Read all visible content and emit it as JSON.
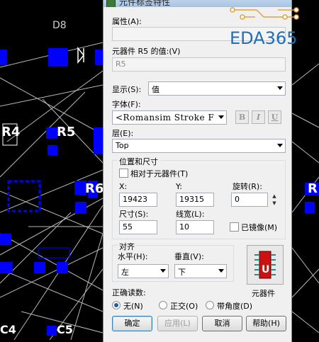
{
  "dialog": {
    "title": "元件标签特性",
    "attribute_label": "属性(A):",
    "attribute_value": "",
    "value_label": "元器件 R5 的值:(V)",
    "value_value": "R5",
    "display_label": "显示(S):",
    "display_value": "值",
    "font_label": "字体(F):",
    "font_value": "<Romansim Stroke F",
    "font_style_bold": "B",
    "font_style_italic": "I",
    "font_style_underline": "U",
    "layer_label": "层(E):",
    "layer_value": "Top",
    "position_group": "位置和尺寸",
    "relative_label": "相对于元器件(T)",
    "x_label": "X:",
    "x_value": "19423",
    "y_label": "Y:",
    "y_value": "19315",
    "rotation_label": "旋转(R):",
    "rotation_value": "0",
    "size_label": "尺寸(S):",
    "size_value": "55",
    "linewidth_label": "线宽(L):",
    "linewidth_value": "10",
    "mirror_label": "已镜像(M)",
    "align_group": "对齐",
    "horizontal_label": "水平(H):",
    "horizontal_value": "左",
    "vertical_label": "垂直(V):",
    "vertical_value": "下",
    "component_label": "元器件",
    "reading_label": "正确读数:",
    "radio_none": "无(N)",
    "radio_ortho": "正交(O)",
    "radio_angle": "带角度(D)",
    "ok": "确定",
    "apply": "应用(L)",
    "cancel": "取消",
    "help": "帮助(H)"
  },
  "watermark": "EDA365",
  "pcb": {
    "labels": [
      "D8",
      "R4",
      "R5",
      "R6",
      "R",
      "C4",
      "C5"
    ]
  },
  "colors": {
    "pad": "#0000ff",
    "trace": "#ffffff",
    "background": "#000000",
    "watermark": "#1f6fb5"
  }
}
